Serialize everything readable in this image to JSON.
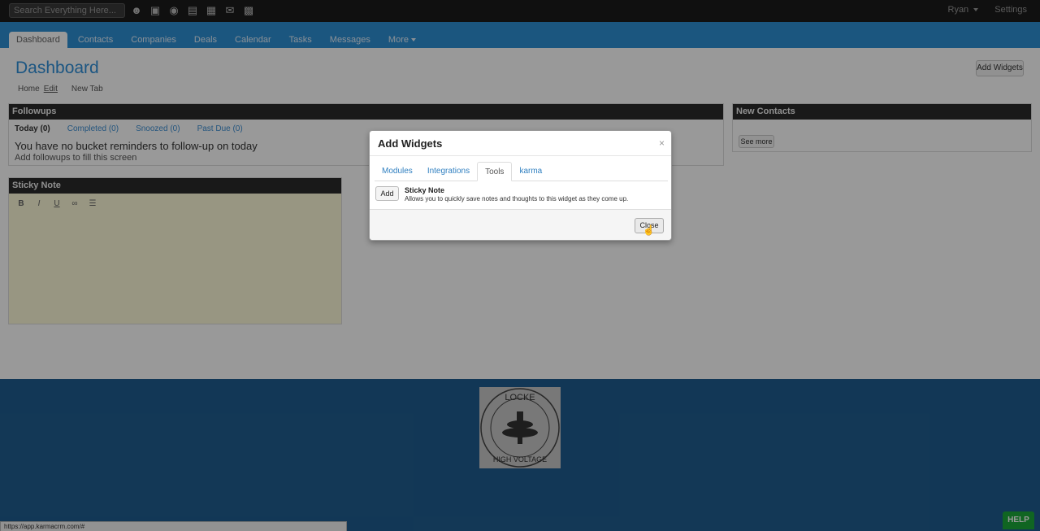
{
  "topbar": {
    "search_placeholder": "Search Everything Here...",
    "icons": [
      "user-icon",
      "building-icon",
      "money-bag-icon",
      "inbox-icon",
      "calendar-icon",
      "mail-icon",
      "chat-icon"
    ],
    "user_label": "Ryan",
    "settings_label": "Settings"
  },
  "nav": {
    "tabs": [
      {
        "label": "Dashboard"
      },
      {
        "label": "Contacts"
      },
      {
        "label": "Companies"
      },
      {
        "label": "Deals"
      },
      {
        "label": "Calendar"
      },
      {
        "label": "Tasks"
      },
      {
        "label": "Messages"
      },
      {
        "label": "More"
      }
    ]
  },
  "page": {
    "title": "Dashboard",
    "subnav": {
      "home": "Home",
      "edit": "Edit",
      "new_tab": "New Tab"
    },
    "add_widgets_label": "Add Widgets"
  },
  "followups": {
    "title": "Followups",
    "tabs": [
      "Today (0)",
      "Completed (0)",
      "Snoozed (0)",
      "Past Due (0)"
    ],
    "message": "You have no bucket reminders to follow-up on today",
    "sub": "Add followups to fill this screen"
  },
  "new_contacts": {
    "title": "New Contacts",
    "see_more": "See more"
  },
  "sticky_note": {
    "title": "Sticky Note",
    "tools": [
      "B",
      "I",
      "U"
    ]
  },
  "footer": {
    "logo_text_top": "LOCKE",
    "logo_text_bottom": "HIGH VOLTAGE",
    "status_url": "https://app.karmacrm.com/#",
    "help_label": "HELP"
  },
  "modal": {
    "title": "Add Widgets",
    "close_x": "×",
    "tabs": [
      {
        "label": "Modules"
      },
      {
        "label": "Integrations"
      },
      {
        "label": "Tools"
      },
      {
        "label": "karma"
      }
    ],
    "widget": {
      "add_label": "Add",
      "name": "Sticky Note",
      "description": "Allows you to quickly save notes and thoughts to this widget as they come up."
    },
    "close_label": "Close"
  },
  "colors": {
    "accent": "#2e8fd4",
    "topbar": "#1b1b1b",
    "footer": "#1f5d8f",
    "help": "#1ca83a"
  }
}
